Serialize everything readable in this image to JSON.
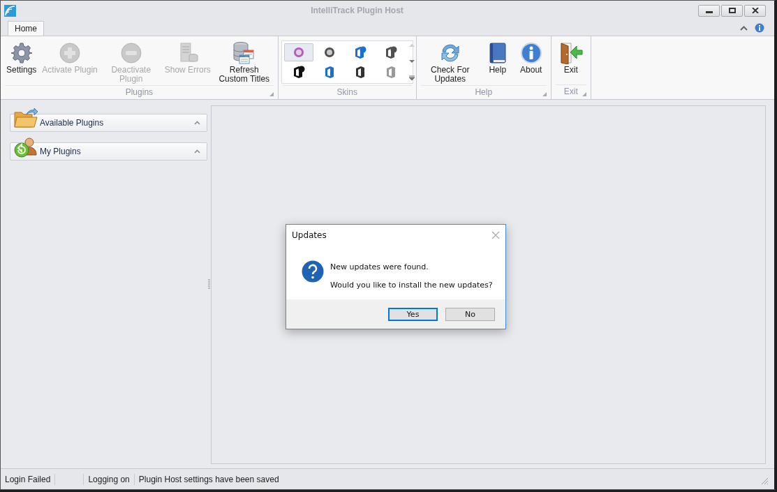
{
  "window": {
    "title": "IntelliTrack Plugin Host"
  },
  "tabs": [
    {
      "label": "Home",
      "selected": true
    }
  ],
  "ribbon_groups": [
    {
      "label": "Plugins",
      "kind": "buttons",
      "buttons": [
        {
          "label": "Settings",
          "kind": "gear",
          "disabled": false
        },
        {
          "label": "Activate Plugin",
          "kind": "plus",
          "disabled": true
        },
        {
          "label": "Deactivate Plugin",
          "kind": "minus",
          "disabled": true
        },
        {
          "label": "Show Errors",
          "kind": "server",
          "disabled": true
        },
        {
          "label": "Refresh Custom Titles",
          "kind": "database",
          "disabled": false
        }
      ]
    },
    {
      "label": "Skins",
      "kind": "gallery",
      "skins": [
        {
          "kind": "disc",
          "color": "#b060b8",
          "selected": true
        },
        {
          "kind": "disc",
          "color": "#505050",
          "selected": false
        },
        {
          "kind": "office16",
          "color": "#1a6fd0",
          "selected": false
        },
        {
          "kind": "office16",
          "color": "#505050",
          "selected": false
        },
        {
          "kind": "office16",
          "color": "#111111",
          "selected": false
        },
        {
          "kind": "office",
          "color": "#1a6fd0",
          "selected": false
        },
        {
          "kind": "office",
          "color": "#333333",
          "selected": false
        },
        {
          "kind": "office",
          "color": "#999999",
          "selected": false
        }
      ]
    },
    {
      "label": "Help",
      "kind": "buttons",
      "buttons": [
        {
          "label": "Check For Updates",
          "kind": "refresh",
          "disabled": false
        },
        {
          "label": "Help",
          "kind": "book",
          "disabled": false
        },
        {
          "label": "About",
          "kind": "info",
          "disabled": false
        }
      ]
    },
    {
      "label": "Exit",
      "kind": "buttons",
      "buttons": [
        {
          "label": "Exit",
          "kind": "door",
          "disabled": false
        }
      ]
    }
  ],
  "nav_groups": [
    {
      "label": "Available Plugins",
      "kind": "folder"
    },
    {
      "label": "My Plugins",
      "kind": "user"
    }
  ],
  "dialog": {
    "title": "Updates",
    "lines": [
      "New updates were found.",
      "Would you like to install the new updates?"
    ],
    "buttons": [
      {
        "label": "Yes",
        "selected": true
      },
      {
        "label": "No",
        "selected": false
      }
    ]
  },
  "status_bar": [
    {
      "kind": "text",
      "text": "Login Failed"
    },
    {
      "kind": "blank"
    },
    {
      "kind": "text",
      "text": "Logging on"
    },
    {
      "kind": "text",
      "text": "Plugin Host settings have been saved"
    }
  ]
}
